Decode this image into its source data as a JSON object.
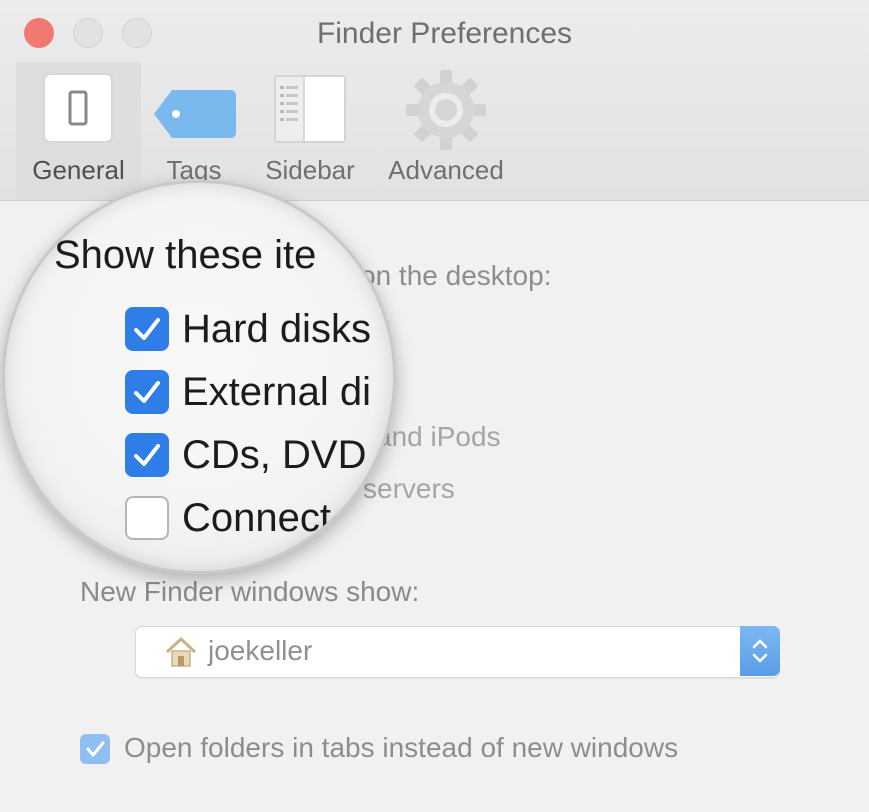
{
  "window": {
    "title": "Finder Preferences",
    "close_color": "#f07a72"
  },
  "toolbar": {
    "tabs": [
      {
        "label": "General",
        "icon": "switch-icon",
        "selected": true
      },
      {
        "label": "Tags",
        "icon": "tag-icon",
        "selected": false
      },
      {
        "label": "Sidebar",
        "icon": "sidebar-icon",
        "selected": false
      },
      {
        "label": "Advanced",
        "icon": "gear-icon",
        "selected": false
      }
    ]
  },
  "general": {
    "desktop_heading_magnified": "Show these ite",
    "desktop_heading_rest": "on the desktop:",
    "items": [
      {
        "magnified_label": "Hard disks",
        "checked": true
      },
      {
        "magnified_label": "External di",
        "checked": true
      },
      {
        "magnified_label": "CDs, DVD",
        "visible_rest": "and iPods",
        "checked": true
      },
      {
        "magnified_label": "Connect",
        "visible_rest": "servers",
        "checked": false
      }
    ],
    "new_window_label": "New Finder windows show:",
    "new_window_value": "joekeller",
    "new_window_icon": "home-icon",
    "open_in_tabs_label": "Open folders in tabs instead of new windows",
    "open_in_tabs_checked": true
  },
  "colors": {
    "accent": "#2f7de6",
    "accent_light": "#8ebff0"
  }
}
